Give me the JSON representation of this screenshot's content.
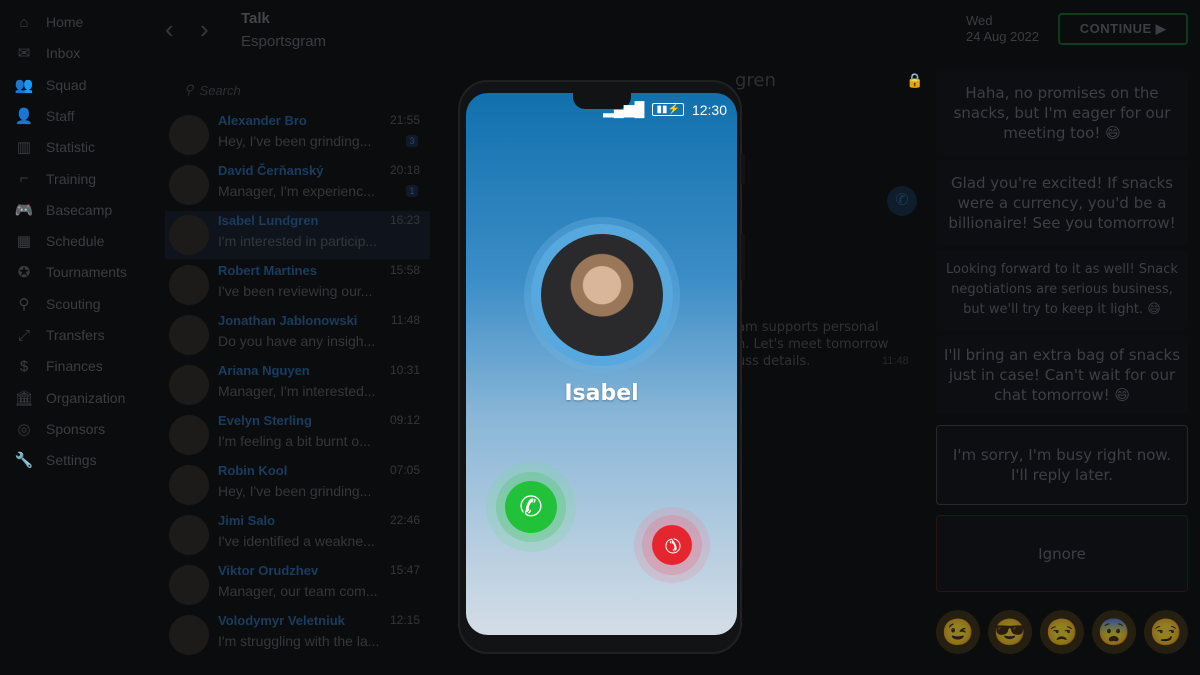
{
  "sidebar": {
    "items": [
      {
        "label": "Home",
        "icon": "home-icon",
        "g": "⌂"
      },
      {
        "label": "Inbox",
        "icon": "mail-icon",
        "g": "✉"
      },
      {
        "label": "Squad",
        "icon": "squad-icon",
        "g": "👥"
      },
      {
        "label": "Staff",
        "icon": "staff-icon",
        "g": "👤"
      },
      {
        "label": "Statistic",
        "icon": "chart-icon",
        "g": "▥"
      },
      {
        "label": "Training",
        "icon": "gun-icon",
        "g": "⌐"
      },
      {
        "label": "Basecamp",
        "icon": "gamepad-icon",
        "g": "🎮"
      },
      {
        "label": "Schedule",
        "icon": "calendar-icon",
        "g": "▦"
      },
      {
        "label": "Tournaments",
        "icon": "medal-icon",
        "g": "✪"
      },
      {
        "label": "Scouting",
        "icon": "search-icon",
        "g": "⚲"
      },
      {
        "label": "Transfers",
        "icon": "transfer-icon",
        "g": "⤢"
      },
      {
        "label": "Finances",
        "icon": "moneybag-icon",
        "g": "$"
      },
      {
        "label": "Organization",
        "icon": "bank-icon",
        "g": "🏛"
      },
      {
        "label": "Sponsors",
        "icon": "coins-icon",
        "g": "◎"
      },
      {
        "label": "Settings",
        "icon": "wrench-icon",
        "g": "🔧"
      }
    ]
  },
  "header": {
    "title": "Talk",
    "subtitle": "Esportsgram",
    "date_day": "Wed",
    "date": "24 Aug 2022",
    "continue_label": "CONTINUE ▶"
  },
  "search": {
    "placeholder": "Search"
  },
  "chats": [
    {
      "name": "Alexander Bro",
      "time": "21:55",
      "preview": "Hey, I've been grinding...",
      "badge": "3"
    },
    {
      "name": "David Čerňanský",
      "time": "20:18",
      "preview": "Manager, I'm experienc...",
      "badge": "1"
    },
    {
      "name": "Isabel Lundgren",
      "time": "16:23",
      "preview": "I'm interested in particip...",
      "selected": true
    },
    {
      "name": "Robert Martines",
      "time": "15:58",
      "preview": "I've been reviewing our..."
    },
    {
      "name": "Jonathan Jablonowski",
      "time": "11:48",
      "preview": "Do you have any insigh..."
    },
    {
      "name": "Ariana Nguyen",
      "time": "10:31",
      "preview": "Manager, I'm interested..."
    },
    {
      "name": "Evelyn Sterling",
      "time": "09:12",
      "preview": "I'm feeling a bit burnt o..."
    },
    {
      "name": "Robin Kool",
      "time": "07:05",
      "preview": "Hey, I've been grinding..."
    },
    {
      "name": "Jimi Salo",
      "time": "22:46",
      "preview": "I've identified a weakne..."
    },
    {
      "name": "Viktor Orudzhev",
      "time": "15:47",
      "preview": "Manager, our team com..."
    },
    {
      "name": "Volodymyr Veletniuk",
      "time": "12:15",
      "preview": "I'm struggling with the la..."
    }
  ],
  "conversation": {
    "title_partial": "gren",
    "message_partial": "am supports personal\nn. Let's meet tomorrow\nuss details.",
    "message_time": "11:48"
  },
  "replies": [
    "Haha, no promises on the snacks, but I'm eager for our meeting too! 😄",
    "Glad you're excited! If snacks were a currency, you'd be a billionaire! See you tomorrow!",
    "Looking forward to it as well! Snack negotiations are serious business, but we'll try to keep it light. 😄",
    "I'll bring an extra bag of snacks just in case! Can't wait for our chat tomorrow! 😄",
    "I'm sorry, I'm busy right now. I'll reply later.",
    "Ignore"
  ],
  "emojis": [
    "😉",
    "😎",
    "😒",
    "😨",
    "😏"
  ],
  "phone": {
    "time": "12:30",
    "caller": "Isabel",
    "accept_color": "#22c13a",
    "decline_color": "#e5262e"
  }
}
